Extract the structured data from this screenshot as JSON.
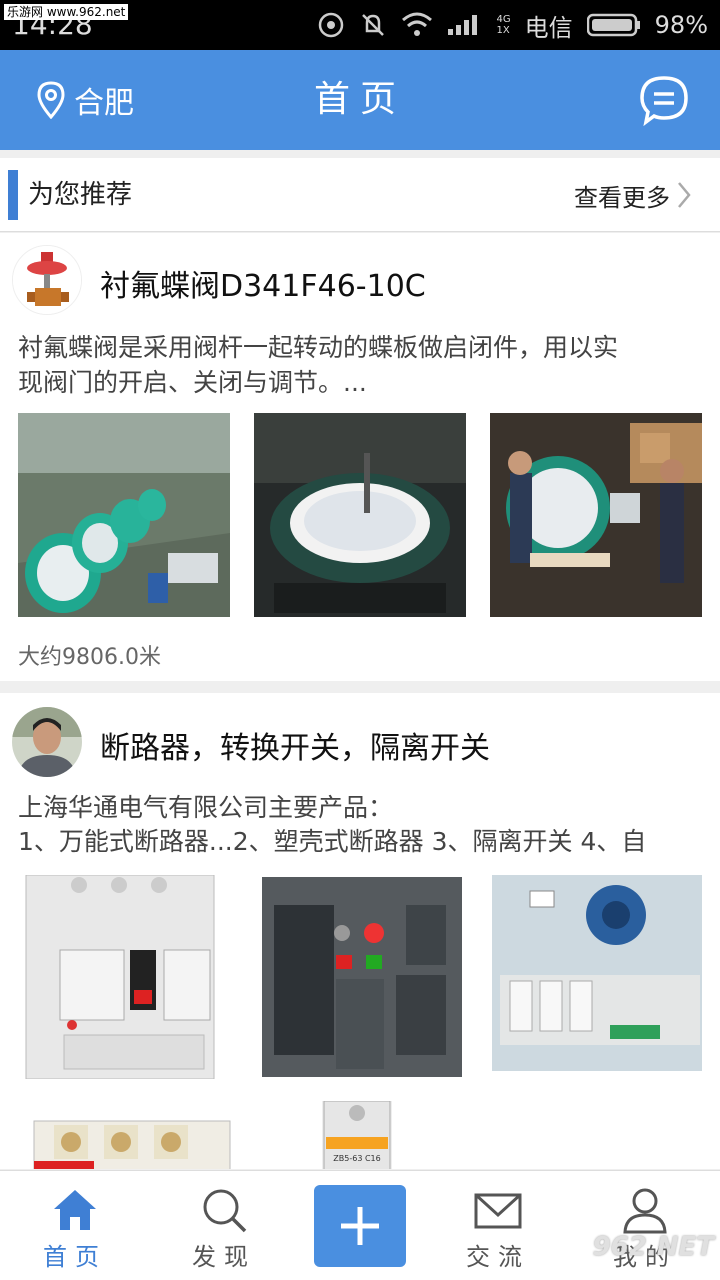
{
  "status_bar": {
    "watermark": "乐游网 www.962.net",
    "time": "14:28",
    "network": [
      "4G",
      "1X"
    ],
    "carrier": "电信",
    "battery": "98%"
  },
  "header": {
    "location": "合肥",
    "title": "首页",
    "location_icon": "location-pin-icon",
    "message_icon": "chat-bubble-icon"
  },
  "section": {
    "title": "为您推荐",
    "more_label": "查看更多"
  },
  "cards": [
    {
      "title": "衬氟蝶阀D341F46-10C",
      "description_line1": "衬氟蝶阀是采用阀杆一起转动的蝶板做启闭件，用以实",
      "description_line2": "现阀门的开启、关闭与调节。...",
      "distance": "大约9806.0米"
    },
    {
      "title": "断路器，转换开关，隔离开关",
      "description_line1": "上海华通电气有限公司主要产品：",
      "description_line2": "1、万能式断路器...2、塑壳式断路器 3、隔离开关 4、自",
      "image_text_1": "ZB5-63 C16"
    }
  ],
  "nav": {
    "items": [
      {
        "label": "首页",
        "icon": "home-icon",
        "active": true
      },
      {
        "label": "发现",
        "icon": "search-icon",
        "active": false
      },
      {
        "label": "",
        "icon": "plus-icon",
        "active": false
      },
      {
        "label": "交流",
        "icon": "mail-icon",
        "active": false
      },
      {
        "label": "我的",
        "icon": "user-icon",
        "active": false
      }
    ]
  },
  "overlay_watermark": "962.NET",
  "colors": {
    "primary": "#4a8fe0",
    "accent_bar": "#3f7fd4"
  }
}
